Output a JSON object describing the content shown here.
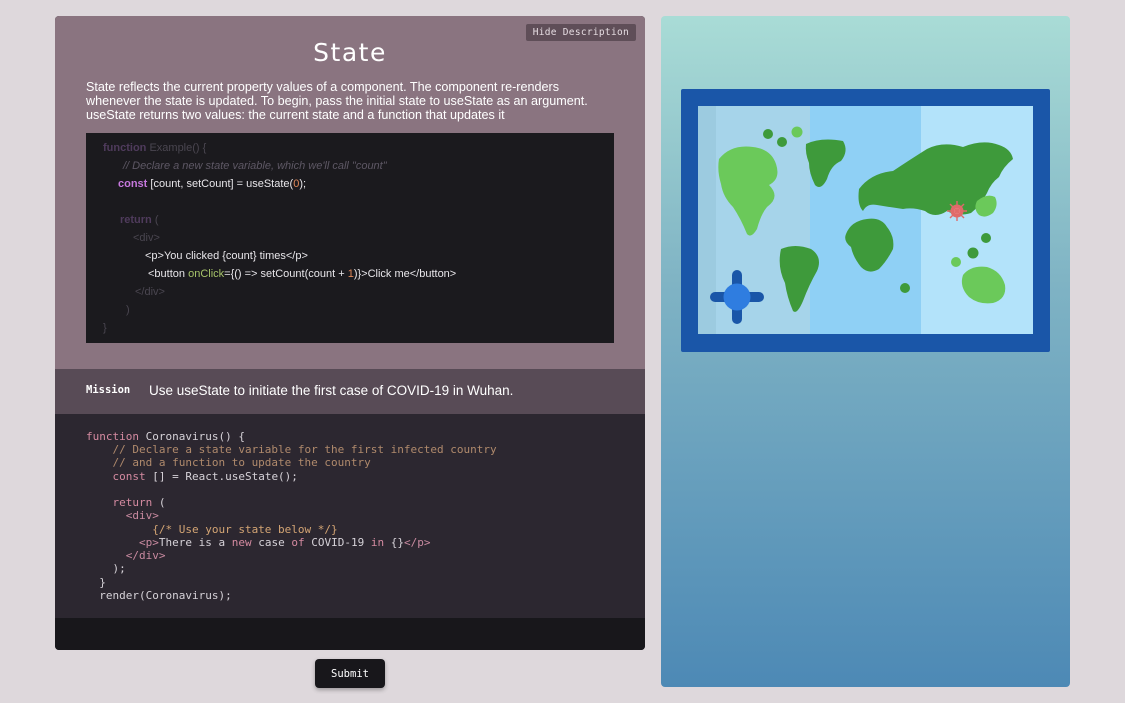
{
  "description": {
    "hide_button": "Hide Description",
    "title": "State",
    "text": "State reflects the current property values of a component. The component re-renders whenever the state is updated. To begin, pass the initial state to useState as an argument. useState returns two values: the current state and a function that updates it"
  },
  "example_code": {
    "line1_kw": "function",
    "line1_rest": " Example() {",
    "line2": "// Declare a new state variable, which we'll call \"count\"",
    "line3_kw": "const",
    "line3_a": " [count, setCount] = useState(",
    "line3_num": "0",
    "line3_b": ");",
    "line4_kw": "return",
    "line4_rest": " (",
    "line5": "<div>",
    "line6": "<p>You clicked {count} times</p>",
    "line7_a": "<button ",
    "line7_attr": "onClick",
    "line7_b": "={() => setCount(count + ",
    "line7_num": "1",
    "line7_c": ")}>Click me</button>",
    "line8": "</div>",
    "line9": ")",
    "line10": "}"
  },
  "mission": {
    "label": "Mission",
    "text": "Use useState to initiate the first case of COVID-19 in Wuhan."
  },
  "editor": {
    "l1_kw": "function",
    "l1_rest": " Coronavirus() {",
    "l2": "    // Declare a state variable for the first infected country",
    "l3": "    // and a function to update the country",
    "l4_kw": "    const",
    "l4_rest": " [] = React.useState();",
    "l5_kw": "    return",
    "l5_rest": " (",
    "l6": "      <div>",
    "l7": "          {/* Use your state below */}",
    "l8_tag1": "        <p>",
    "l8_a": "There is a ",
    "l8_new": "new",
    "l8_b": " case ",
    "l8_of": "of",
    "l8_c": " COVID-19 ",
    "l8_in": "in",
    "l8_d": " {}",
    "l8_tag2": "</p>",
    "l9": "      </div>",
    "l10": "    );",
    "l11": "  }",
    "l12": "  render(Coronavirus);"
  },
  "submit_label": "Submit",
  "icons": {
    "map": "world-map-icon",
    "virus": "virus-icon",
    "pin": "location-pin-icon"
  },
  "colors": {
    "description_bg": "#8a7480",
    "mission_bg": "#584b56",
    "editor_bg": "#2c2730",
    "map_frame": "#1a56a8",
    "map_land": "#4caf50"
  }
}
